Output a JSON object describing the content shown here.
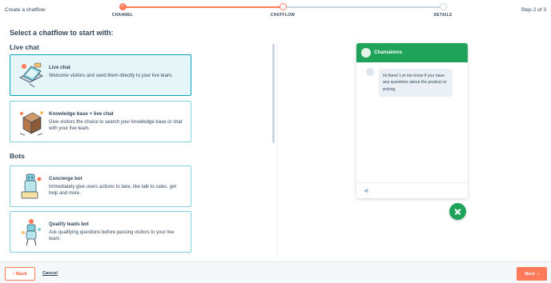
{
  "header": {
    "breadcrumb": "Create a chatflow",
    "step_indicator": "Step 2 of 3",
    "steps": [
      {
        "label": "CHANNEL",
        "state": "done"
      },
      {
        "label": "CHATFLOW",
        "state": "current"
      },
      {
        "label": "DETAILS",
        "state": "upcoming"
      }
    ]
  },
  "main": {
    "heading": "Select a chatflow to start with:",
    "sections": [
      {
        "title": "Live chat",
        "cards": [
          {
            "title": "Live chat",
            "description": "Welcome visitors and send them directly to your live team.",
            "icon": "laptop-chat-icon",
            "selected": true
          },
          {
            "title": "Knowledge base + live chat",
            "description": "Give visitors the choice to search your knowledge base or chat with your live team.",
            "icon": "knowledge-base-box-icon",
            "selected": false
          }
        ]
      },
      {
        "title": "Bots",
        "cards": [
          {
            "title": "Concierge bot",
            "description": "Immediately give users actions to take, like talk to sales, get help and more.",
            "icon": "concierge-bot-icon",
            "selected": false
          },
          {
            "title": "Qualify leads bot",
            "description": "Ask qualifying questions before passing visitors to your live team.",
            "icon": "qualify-leads-bot-icon",
            "selected": false
          }
        ]
      }
    ]
  },
  "preview": {
    "chat_name": "Chamaimos",
    "message": "Hi there! Let me know if you have any questions about the product or pricing.",
    "header_color": "#1fa35b"
  },
  "footer": {
    "back_label": "Back",
    "cancel_label": "Cancel",
    "next_label": "Next"
  },
  "colors": {
    "accent": "#ff7a59",
    "selected_border": "#00a4bd",
    "chat_green": "#1fa35b"
  }
}
